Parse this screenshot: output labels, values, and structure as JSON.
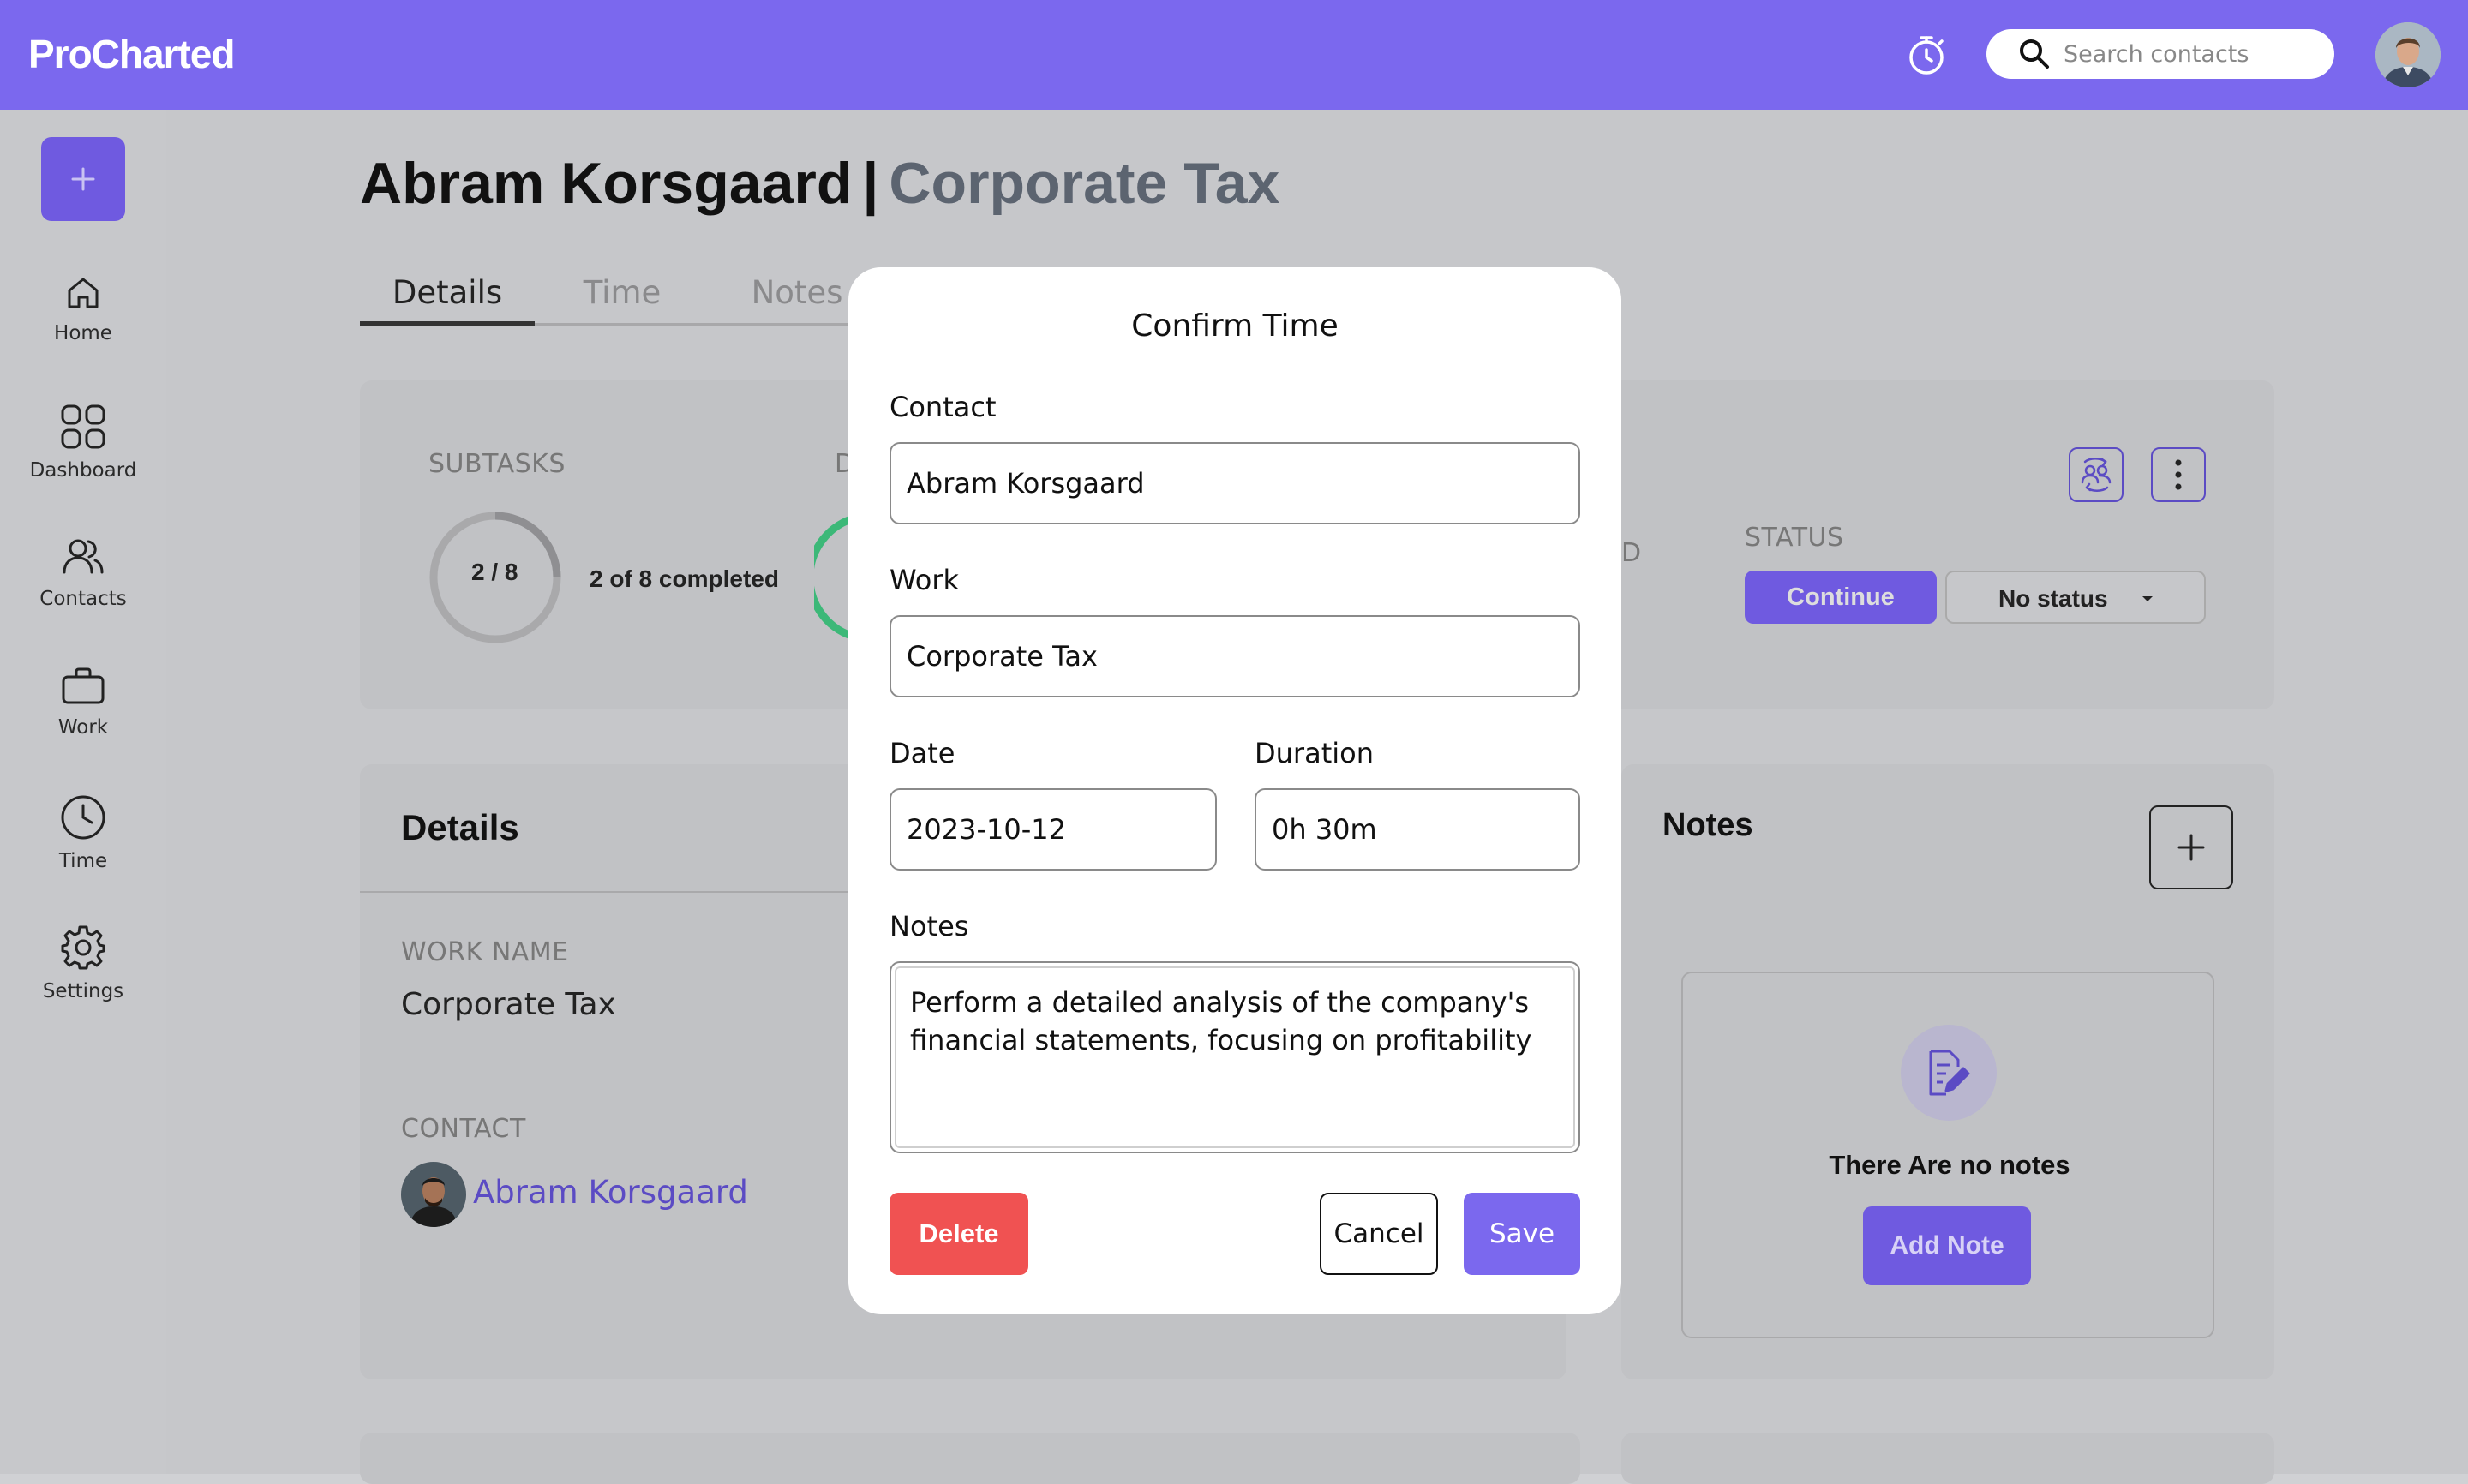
{
  "app": {
    "brand": "ProCharted"
  },
  "search": {
    "placeholder": "Search contacts"
  },
  "sidebar": {
    "items": [
      {
        "label": "Home"
      },
      {
        "label": "Dashboard"
      },
      {
        "label": "Contacts"
      },
      {
        "label": "Work"
      },
      {
        "label": "Time"
      },
      {
        "label": "Settings"
      }
    ]
  },
  "page": {
    "contact_name": "Abram Korsgaard",
    "separator": "|",
    "work_name": "Corporate Tax",
    "tabs": [
      {
        "label": "Details"
      },
      {
        "label": "Time"
      },
      {
        "label": "Notes"
      }
    ]
  },
  "summary": {
    "subtasks_label": "SUBTASKS",
    "subtasks_ring": "2 / 8",
    "subtasks_text": "2 of 8 completed",
    "subtasks_completed": 2,
    "subtasks_total": 8,
    "hidden_label_fragment_left": "D",
    "hidden_label_fragment_right": "D",
    "status_label": "STATUS",
    "continue_label": "Continue",
    "status_value": "No status"
  },
  "details": {
    "title": "Details",
    "work_name_label": "WORK NAME",
    "work_name_value": "Corporate Tax",
    "contact_label": "CONTACT",
    "contact_value": "Abram Korsgaard"
  },
  "notes_panel": {
    "title": "Notes",
    "empty_text": "There Are no notes",
    "add_note_label": "Add Note"
  },
  "modal": {
    "title": "Confirm Time",
    "contact_label": "Contact",
    "contact_value": "Abram Korsgaard",
    "work_label": "Work",
    "work_value": "Corporate Tax",
    "date_label": "Date",
    "date_value": "2023-10-12",
    "duration_label": "Duration",
    "duration_value": "0h 30m",
    "notes_label": "Notes",
    "notes_value": "Perform a detailed analysis of the company's financial statements, focusing on profitability",
    "delete_label": "Delete",
    "cancel_label": "Cancel",
    "save_label": "Save"
  },
  "colors": {
    "brand": "#7b68ee",
    "accent": "#6f5ae0",
    "danger": "#f05252",
    "progress_green": "#3cb878"
  }
}
